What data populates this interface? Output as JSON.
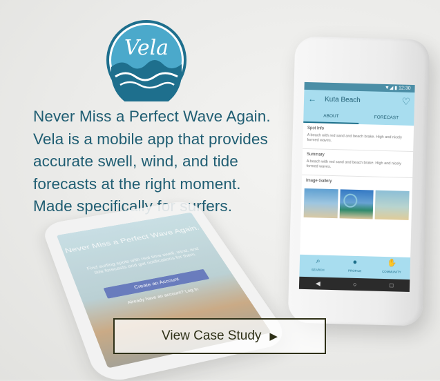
{
  "logo": {
    "text": "Vela",
    "icon": "wave-icon",
    "color": "#1e6f8d",
    "bg": "#4ba9cb"
  },
  "tagline": {
    "lines": [
      "Never Miss a Perfect Wave Again.",
      "Vela is a mobile app that provides",
      "accurate swell, wind, and tide",
      "forecasts at the right moment.",
      "Made specifically for surfers."
    ]
  },
  "back_phone": {
    "title": "Never Miss a Perfect Wave Again.",
    "text": "Find surfing spots with real time swell, wind, and tide forecasts and get notifications for them.",
    "button": "Create an Account",
    "signin": "Already have an account? Log In"
  },
  "front_phone": {
    "status_time": "12:30",
    "title": "Kuta Beach",
    "tabs": [
      "ABOUT",
      "FORECAST"
    ],
    "spot_info_heading": "Spot Info",
    "spot_info_text": "A beach with red sand and beach brake. High and nicely formed waves.",
    "summary_heading": "Summary",
    "summary_text": "A beach with red sand and beach brake. High and nicely formed waves.",
    "gallery_heading": "Image Gallery",
    "nav": [
      "SEARCH",
      "PROFILE",
      "COMMUNITY"
    ]
  },
  "cta": {
    "label": "View Case Study",
    "icon": "play-triangle-icon"
  },
  "colors": {
    "text": "#1f5d72",
    "cta": "#2e3017",
    "app_accent": "#a8ddef"
  }
}
